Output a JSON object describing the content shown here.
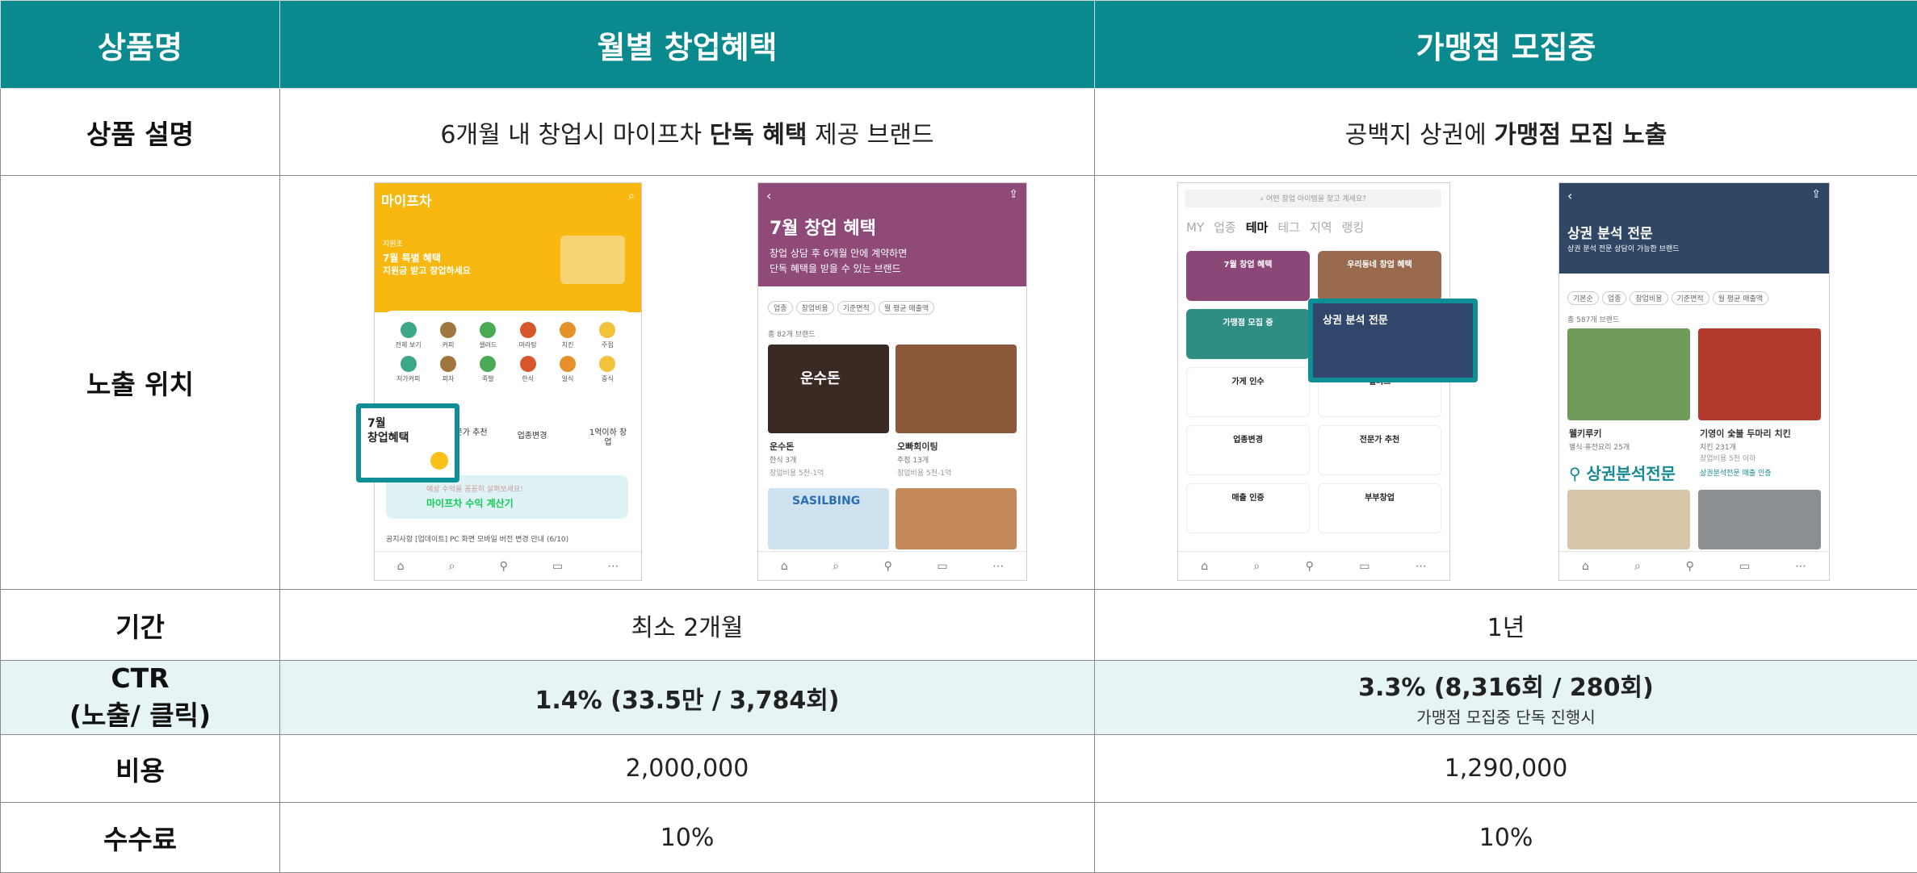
{
  "header": {
    "col_label": "상품명",
    "col_a": "월별 창업혜택",
    "col_b": "가맹점 모집중"
  },
  "rows": {
    "desc": {
      "label": "상품 설명",
      "a_pre": "6개월 내 창업시 마이프차 ",
      "a_bold": "단독 혜택",
      "a_post": " 제공 브랜드",
      "b_pre": "공백지 상권에 ",
      "b_bold": "가맹점 모집 노출",
      "b_post": ""
    },
    "position": {
      "label": "노출 위치"
    },
    "period": {
      "label": "기간",
      "a": "최소 2개월",
      "b": "1년"
    },
    "ctr": {
      "label_1": "CTR",
      "label_2": "(노출/ 클릭)",
      "a": "1.4% (33.5만 / 3,784회)",
      "b": "3.3% (8,316회 / 280회)",
      "b_note": "가맹점 모집중 단독 진행시"
    },
    "cost": {
      "label": "비용",
      "a": "2,000,000",
      "b": "1,290,000"
    },
    "fee": {
      "label": "수수료",
      "a": "10%",
      "b": "10%"
    }
  },
  "screens": {
    "s1": {
      "logo": "마이프차",
      "small": "지원초",
      "banner_1": "7월 특별 혜택",
      "banner_2": "지원금 받고 창업하세요",
      "cats": [
        "전체 보기",
        "커피",
        "샐러드",
        "마라탕",
        "치킨",
        "주점",
        "저가커피",
        "피자",
        "족발",
        "한식",
        "일식",
        "중식"
      ],
      "hl_1": "7월",
      "hl_2": "창업혜택",
      "btn_1": "전문가 추천",
      "btn_2": "업종변경",
      "btn_3": "1억이하 창업",
      "calc_sub": "예상 수익을 꼼꼼히 살펴보세요!",
      "calc": "마이프차 수익 계산기",
      "notice": "공지사항  [업데이트] PC 화면 모바일 버전 변경 안내 (6/10)",
      "tabs": [
        "홈",
        "브랜드 찾기",
        "상권분석",
        "예약",
        "더보기"
      ]
    },
    "s2": {
      "title": "7월 창업 혜택",
      "sub_1": "창업 상담 후 6개월 안에 계약하면",
      "sub_2": "단독 혜택을 받을 수 있는 브랜드",
      "filters": [
        "업종",
        "창업비용",
        "기준면적",
        "월 평균 매출액"
      ],
      "count": "총 82개 브랜드",
      "brand_1": "운수돈",
      "brand_1_cat": "한식  3개",
      "brand_1_cost": "창업비용 5천-1억",
      "brand_2": "오빠회이팅",
      "brand_2_cat": "주점  13개",
      "brand_2_cost": "창업비용 5천-1억",
      "img_text": "운수돈",
      "img_text_2": "SASILBING"
    },
    "s3": {
      "search": "어떤 창업 아이템을 찾고 계세요?",
      "tabs": [
        "MY",
        "업종",
        "테마",
        "테그",
        "지역",
        "랭킹"
      ],
      "cards": [
        "7월 창업 혜택",
        "우리동네 창업 혜택",
        "가맹점 모집 중",
        "상권 분석 전문",
        "가게 인수",
        "샐러드",
        "업종변경",
        "전문가 추천",
        "매출 인증",
        "부부창업"
      ]
    },
    "s4": {
      "title": "상권 분석 전문",
      "sub": "상권 분석 전문 상담이 가능한 브랜드",
      "filters": [
        "기본순",
        "업종",
        "창업비용",
        "기준면적",
        "월 평균 매출액"
      ],
      "count": "총 587개 브랜드",
      "brand_1": "웰키루키",
      "brand_1_cat": "별식·퓨전요리  25개",
      "brand_2": "기영이 숯불 두마리 치킨",
      "brand_2_cat": "치킨  231개",
      "brand_2_cost": "창업비용 5천 이하",
      "badge": "상권분석전문",
      "badge_small": "상권분석전문  매출 인증"
    }
  },
  "colors": {
    "header_bg": "#0a8a8f",
    "highlight_row": "#e6f4f5",
    "accent": "#0f8f95"
  }
}
